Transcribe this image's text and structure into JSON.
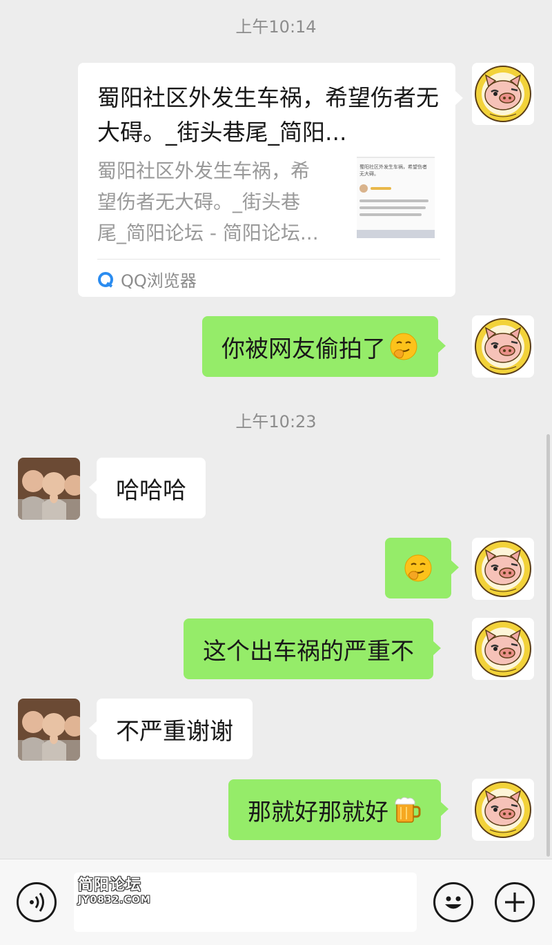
{
  "messages": {
    "time1": "上午10:14",
    "card": {
      "title": "蜀阳社区外发生车祸，希望伤者无大碍。_街头巷尾_简阳...",
      "desc_line1": "蜀阳社区外发生车祸，希",
      "desc_line2": "望伤者无大碍。_街头巷",
      "desc_line3": "尾_简阳论坛 - 简阳论坛...",
      "thumb_title": "蜀阳社区外发生车祸，希望伤者无大碍。",
      "source": "QQ浏览器"
    },
    "msg1": "你被网友偷拍了",
    "time2": "上午10:23",
    "msg2": "哈哈哈",
    "msg4": "这个出车祸的严重不",
    "msg5": "不严重谢谢",
    "msg6": "那就好那就好"
  },
  "emojis": {
    "msg1_emoji": "smirk-face-emoji",
    "msg3_emoji": "smirk-face-emoji",
    "msg6_emoji": "beer-emoji"
  },
  "input_bar": {
    "watermark_line1": "简阳论坛",
    "watermark_line2": "JY0832.COM"
  },
  "colors": {
    "background": "#ededed",
    "my_bubble": "#95ec69",
    "their_bubble": "#ffffff",
    "timestamp": "#8c8c8c"
  }
}
